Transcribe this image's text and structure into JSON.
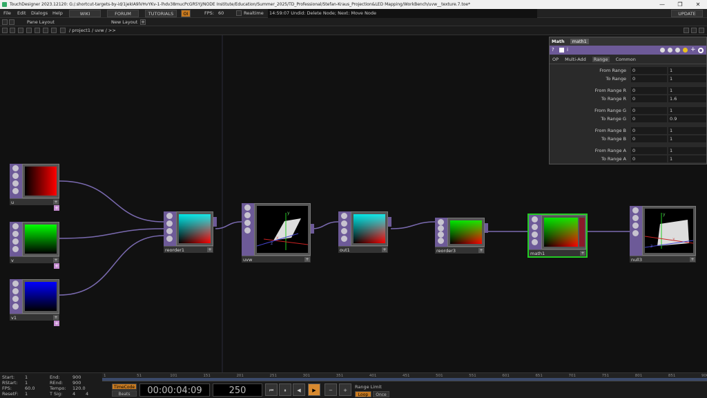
{
  "window": {
    "title": "TouchDesigner 2023.12120: G:/.shortcut-targets-by-id/1jekIA9lVHvYKv-1-lhdv38mucPcGR5YJ/NODE Institute/Education/Summer_2025/TD_Professional/Stefan-Kraus_Projection&LED Mapping/WorkBench/uvw__texture.7.toe*",
    "minimize": "—",
    "maximize": "❐",
    "close": "✕"
  },
  "menu": {
    "items": [
      "File",
      "Edit",
      "Dialogs",
      "Help"
    ],
    "wiki": "WIKI",
    "forum": "FORUM",
    "tutorials": "TUTORIALS",
    "oi": "OI",
    "fps_label": "FPS:",
    "fps_value": "60",
    "realtime": "Realtime",
    "status": "14:59:07 Undid: Delete Node; Next: Move Node",
    "update": "UPDATE"
  },
  "toolbar": {
    "pane_layout": "Pane Layout",
    "new_layout": "New Layout"
  },
  "path": {
    "text": "/ project1 / uvw / >>"
  },
  "nodes": {
    "u": "u",
    "v": "v",
    "v1": "v1",
    "reorder1": "reorder1",
    "uvw": "uvw",
    "out1": "out1",
    "reorder3": "reorder3",
    "math1": "math1",
    "null3": "null3",
    "plus": "+",
    "axis_y": "y",
    "axis_x": "x",
    "axis_z": "z"
  },
  "panel": {
    "op_type": "Math",
    "op_name": "math1",
    "tabs": [
      "OP",
      "Multi-Add",
      "Range",
      "Common"
    ],
    "active_tab": "Range",
    "params": [
      {
        "label": "From Range",
        "v1": "0",
        "v2": "1"
      },
      {
        "label": "To Range",
        "v1": "0",
        "v2": "1"
      },
      {
        "label": "From Range R",
        "v1": "0",
        "v2": "1"
      },
      {
        "label": "To Range R",
        "v1": "0",
        "v2": "1.6"
      },
      {
        "label": "From Range G",
        "v1": "0",
        "v2": "1"
      },
      {
        "label": "To Range G",
        "v1": "0",
        "v2": "0.9"
      },
      {
        "label": "From Range B",
        "v1": "0",
        "v2": "1"
      },
      {
        "label": "To Range B",
        "v1": "0",
        "v2": "1"
      },
      {
        "label": "From Range A",
        "v1": "0",
        "v2": "1"
      },
      {
        "label": "To Range A",
        "v1": "0",
        "v2": "1"
      }
    ]
  },
  "stats": {
    "start_l": "Start:",
    "start_v": "1",
    "rstart_l": "RStart:",
    "rstart_v": "1",
    "fps_l": "FPS:",
    "fps_v": "60.0",
    "resetf_l": "ResetF:",
    "resetf_v": "1",
    "end_l": "End:",
    "end_v": "900",
    "rend_l": "REnd:",
    "rend_v": "900",
    "tempo_l": "Tempo:",
    "tempo_v": "120.0",
    "tsig_l": "T Sig:",
    "tsig_v1": "4",
    "tsig_v2": "4"
  },
  "timeline": {
    "ticks": [
      "1",
      "51",
      "101",
      "151",
      "201",
      "251",
      "301",
      "351",
      "401",
      "451",
      "501",
      "551",
      "601",
      "651",
      "701",
      "751",
      "801",
      "851",
      "900"
    ],
    "timecode_label": "TimeCode",
    "beats_label": "Beats",
    "timecode": "00:00:04:09",
    "frame": "250",
    "range_limit": "Range Limit",
    "loop": "Loop",
    "once": "Once"
  }
}
